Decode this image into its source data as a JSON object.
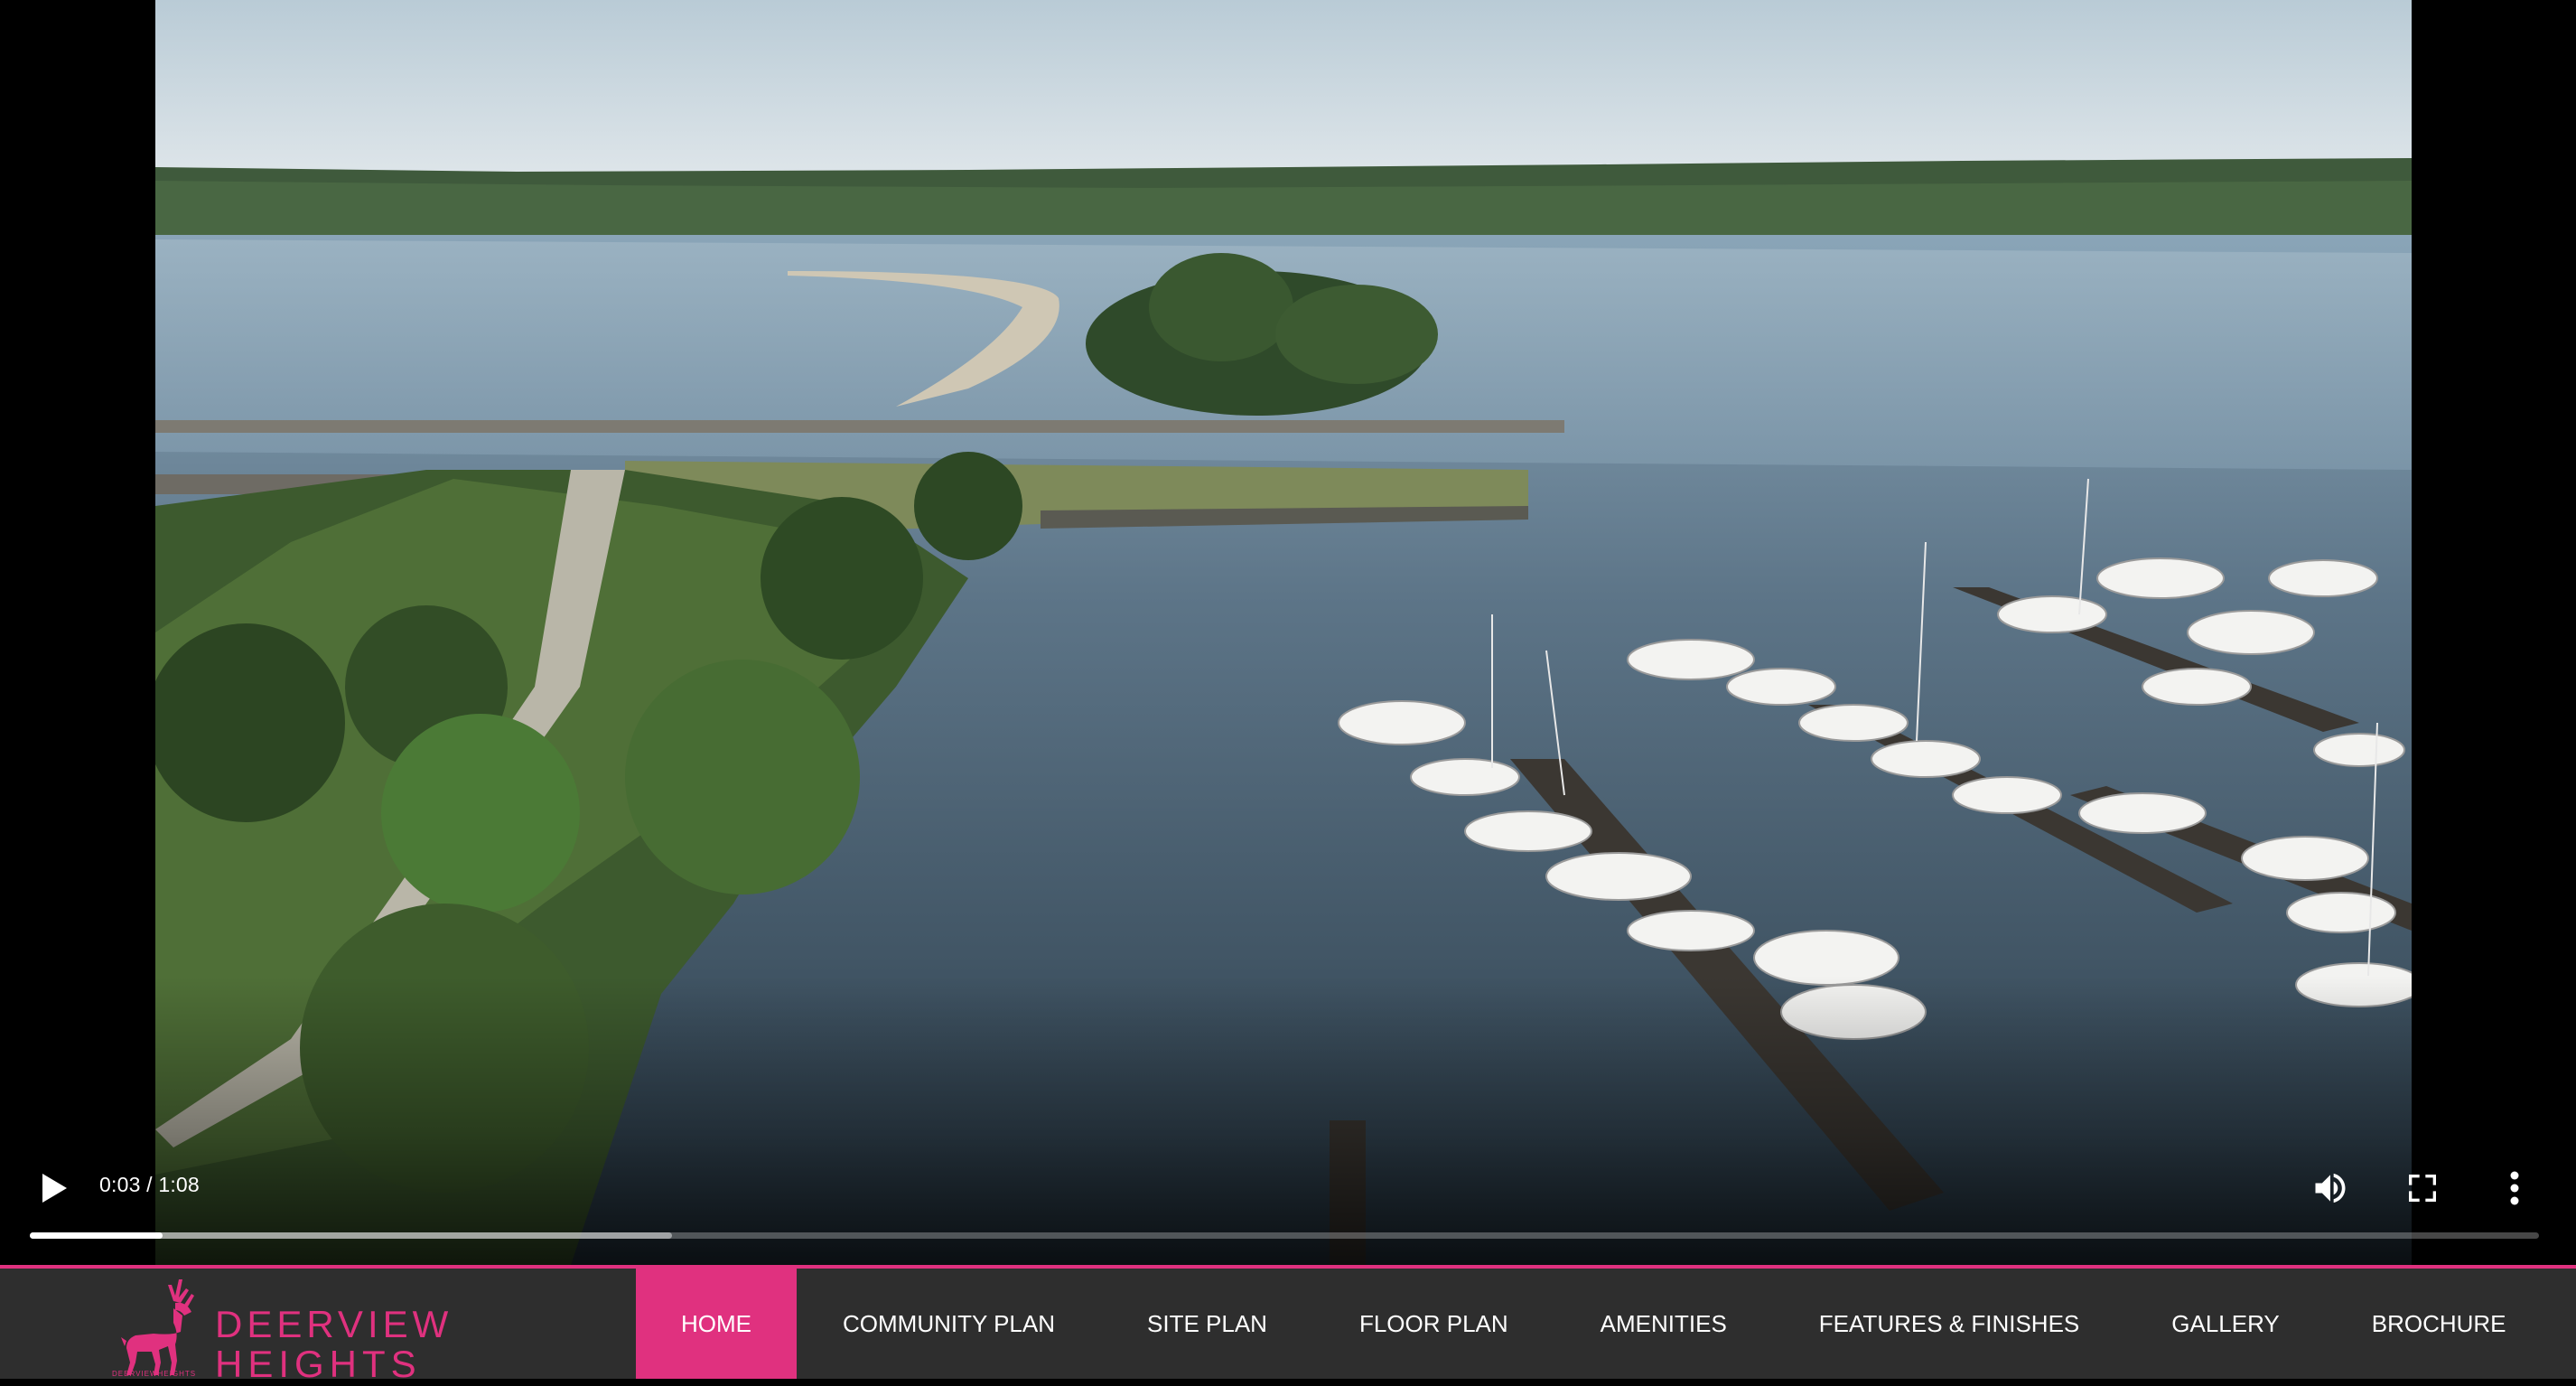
{
  "video": {
    "current_time": "0:03",
    "duration": "1:08",
    "time_display": "0:03 / 1:08",
    "played_fraction": 0.053,
    "buffered_fraction": 0.256,
    "playing": false,
    "controls": {
      "play_icon": "play-icon",
      "volume_icon": "volume-icon",
      "fullscreen_icon": "fullscreen-icon",
      "more_icon": "more-vert-icon"
    }
  },
  "brand": {
    "name_line1": "DEERVIEW",
    "name_line2": "HEIGHTS",
    "tagline": "DEERVIEWHEIGHTS",
    "color": "#e0317f",
    "logo_icon": "deer-icon"
  },
  "nav": {
    "items": [
      {
        "label": "HOME",
        "active": true
      },
      {
        "label": "COMMUNITY PLAN",
        "active": false
      },
      {
        "label": "SITE PLAN",
        "active": false
      },
      {
        "label": "FLOOR PLAN",
        "active": false
      },
      {
        "label": "AMENITIES",
        "active": false
      },
      {
        "label": "FEATURES & FINISHES",
        "active": false
      },
      {
        "label": "GALLERY",
        "active": false
      },
      {
        "label": "BROCHURE",
        "active": false
      }
    ]
  },
  "colors": {
    "accent": "#e0317f",
    "navbar_bg": "#2e2e2e"
  }
}
